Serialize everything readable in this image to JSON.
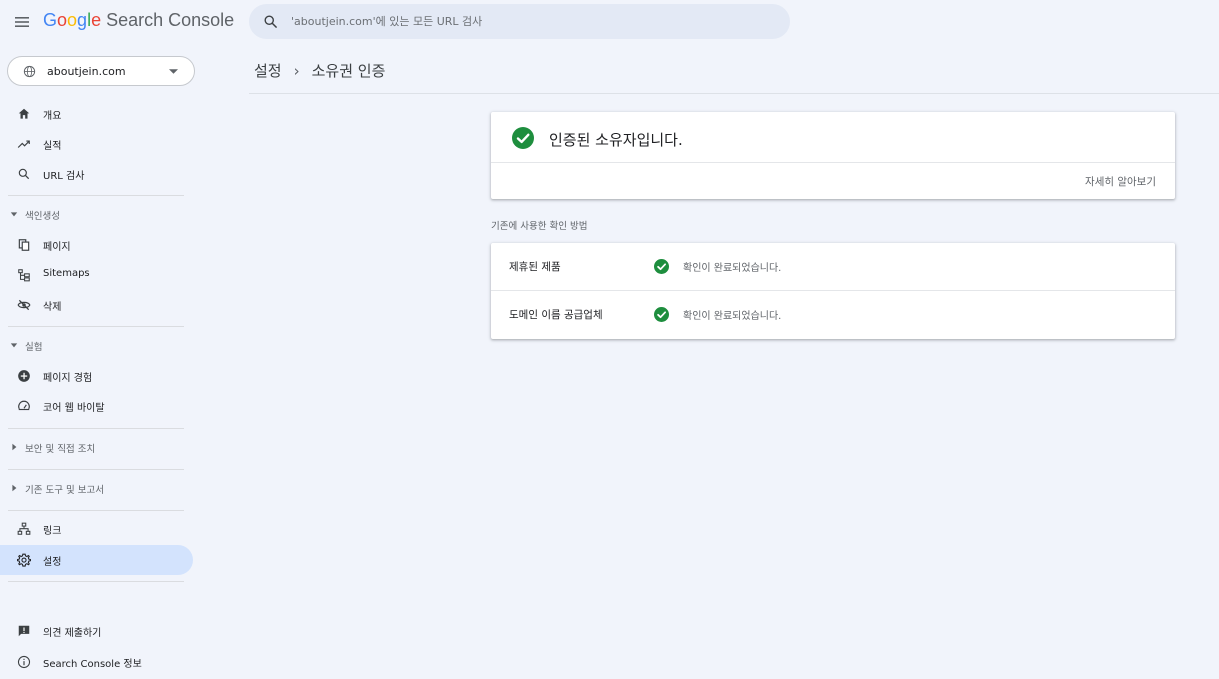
{
  "header": {
    "logo_letters": [
      "G",
      "o",
      "o",
      "g",
      "l",
      "e"
    ],
    "product_name": "Search Console",
    "search_placeholder": "'aboutjein.com'에 있는 모든 URL 검사"
  },
  "property": {
    "name": "aboutjein.com"
  },
  "sidebar": {
    "top_items": [
      {
        "label": "개요",
        "icon": "home-icon"
      },
      {
        "label": "실적",
        "icon": "trending-icon"
      },
      {
        "label": "URL 검사",
        "icon": "search-icon"
      }
    ],
    "indexing": {
      "header": "색인생성",
      "items": [
        {
          "label": "페이지",
          "icon": "pages-icon"
        },
        {
          "label": "Sitemaps",
          "icon": "sitemap-icon"
        },
        {
          "label": "삭제",
          "icon": "removal-icon"
        }
      ]
    },
    "experience": {
      "header": "실험",
      "items": [
        {
          "label": "페이지 경험",
          "icon": "add-circle-icon"
        },
        {
          "label": "코어 웹 바이탈",
          "icon": "speed-icon"
        }
      ]
    },
    "security": {
      "header": "보안 및 직접 조치"
    },
    "legacy": {
      "header": "기존 도구 및 보고서"
    },
    "bottom_items": [
      {
        "label": "링크",
        "icon": "links-icon"
      },
      {
        "label": "설정",
        "icon": "settings-icon",
        "active": true
      }
    ],
    "footer_items": [
      {
        "label": "의견 제출하기",
        "icon": "feedback-icon"
      },
      {
        "label": "Search Console 정보",
        "icon": "info-icon"
      }
    ]
  },
  "main": {
    "breadcrumb": {
      "parent": "설정",
      "separator": "›",
      "current": "소유권 인증"
    },
    "verified_card": {
      "title": "인증된 소유자입니다.",
      "learn_more": "자세히 알아보기"
    },
    "previous_methods_label": "기존에 사용한 확인 방법",
    "methods": [
      {
        "name": "제휴된 제품",
        "status": "확인이 완료되었습니다."
      },
      {
        "name": "도메인 이름 공급업체",
        "status": "확인이 완료되었습니다."
      }
    ]
  },
  "colors": {
    "accent_green": "#1e8e3e",
    "active_bg": "#d3e3fd",
    "page_bg": "#f1f4fb"
  }
}
